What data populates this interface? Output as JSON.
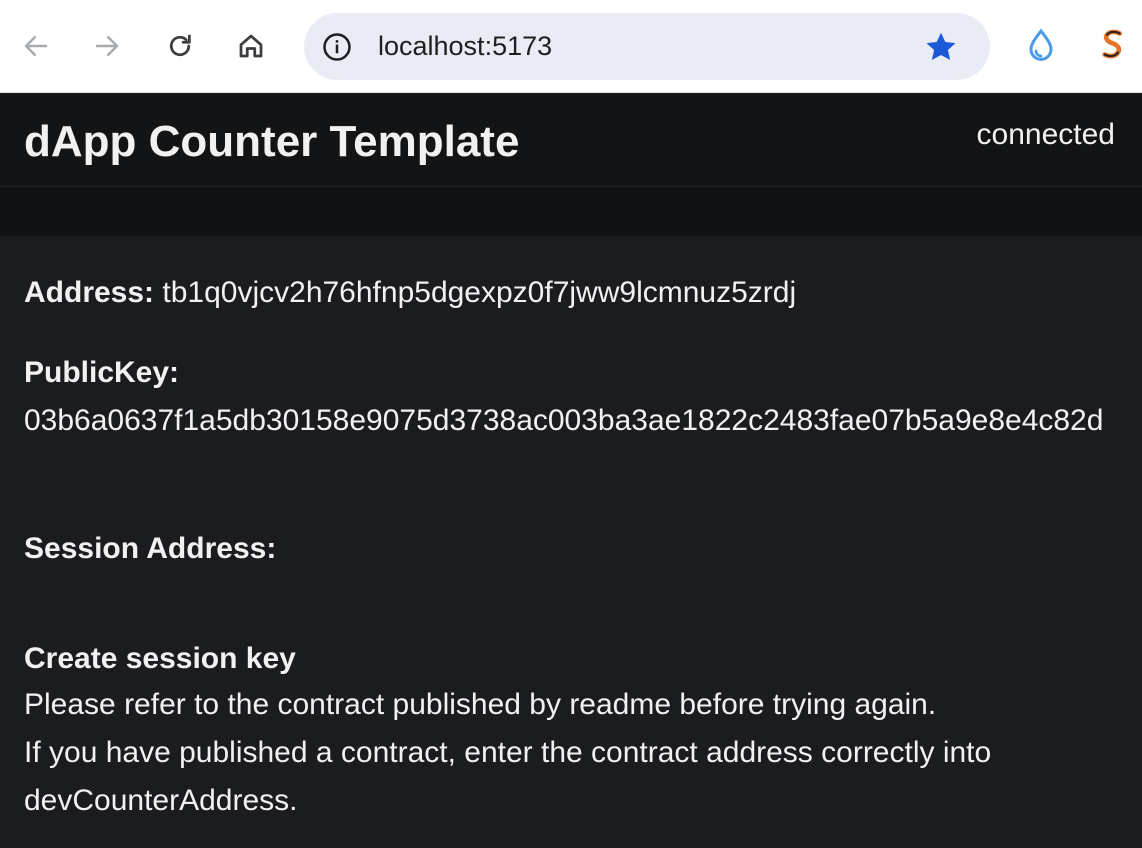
{
  "browser": {
    "url": "localhost:5173",
    "icons": {
      "back": "arrow-left-icon",
      "forward": "arrow-right-icon",
      "reload": "reload-icon",
      "home": "home-icon",
      "site_info": "info-icon",
      "bookmark": "star-icon",
      "extension_1": "droplet-icon",
      "extension_2": "wallet-extension-icon"
    },
    "colors": {
      "bookmark_star": "#1a5ad7",
      "omnibox_bg": "#e9ecf4"
    }
  },
  "header": {
    "title": "dApp Counter Template",
    "status": "connected"
  },
  "account": {
    "address_label": "Address:",
    "address_value": "tb1q0vjcv2h76hfnp5dgexpz0f7jww9lcmnuz5zrdj",
    "pubkey_label": "PublicKey:",
    "pubkey_value": "03b6a0637f1a5db30158e9075d3738ac003ba3ae1822c2483fae07b5a9e8e4c82d",
    "session_address_label": "Session Address:",
    "session_address_value": ""
  },
  "session": {
    "title": "Create session key",
    "message_1": "Please refer to the contract published by readme before trying again.",
    "message_2": "If you have published a contract, enter the contract address correctly into devCounterAddress."
  },
  "theme": {
    "page_bg": "#1b1c1f",
    "header_bg": "#131416",
    "text": "#f1f1f1"
  }
}
